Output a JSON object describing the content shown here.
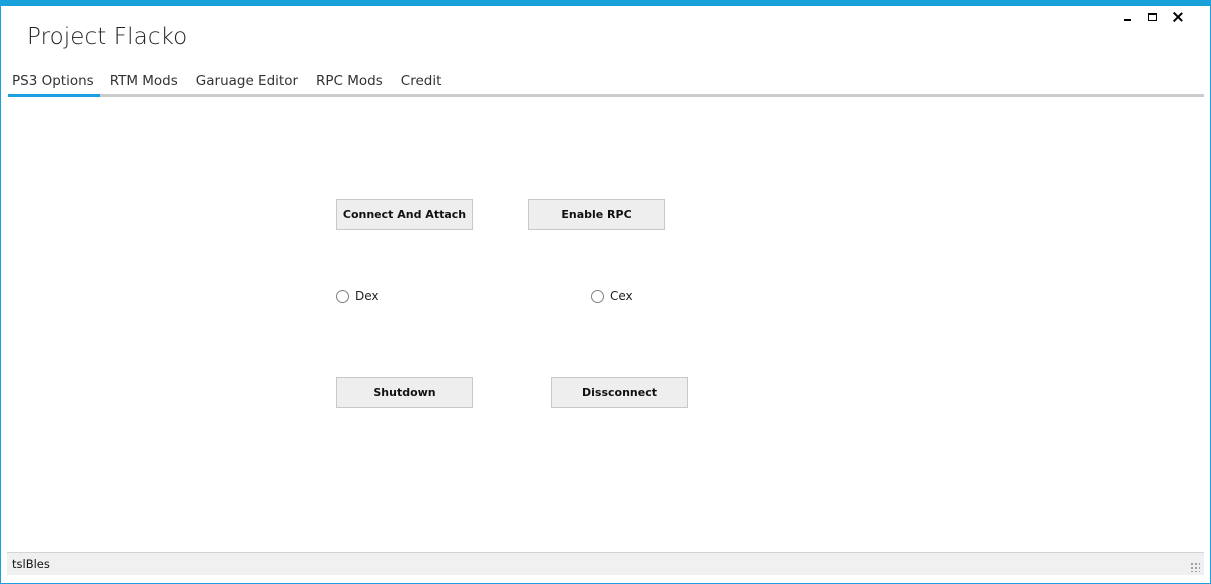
{
  "app": {
    "title": "Project Flacko"
  },
  "tabs": [
    {
      "label": "PS3 Options"
    },
    {
      "label": "RTM Mods"
    },
    {
      "label": "Garuage Editor"
    },
    {
      "label": "RPC Mods"
    },
    {
      "label": "Credit"
    }
  ],
  "active_tab": "PS3 Options",
  "buttons": {
    "connect": "Connect And Attach",
    "enable_rpc": "Enable RPC",
    "shutdown": "Shutdown",
    "disconnect": "Dissconnect"
  },
  "radios": {
    "dex": {
      "label": "Dex",
      "checked": false
    },
    "cex": {
      "label": "Cex",
      "checked": false
    }
  },
  "status": {
    "text": "tslBles"
  },
  "colors": {
    "accent": "#1ba1e2",
    "button_bg": "#eeeeee"
  },
  "icons": [
    "minimize-icon",
    "maximize-icon",
    "close-icon",
    "resize-grip-icon"
  ]
}
